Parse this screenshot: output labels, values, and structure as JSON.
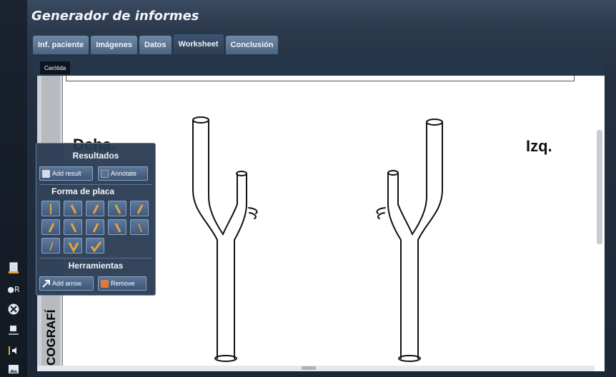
{
  "app": {
    "title": "Generador de informes"
  },
  "tabs": [
    {
      "label": "Inf. paciente"
    },
    {
      "label": "Imágenes"
    },
    {
      "label": "Datos"
    },
    {
      "label": "Worksheet",
      "active": true
    },
    {
      "label": "Conclusión"
    }
  ],
  "subtab": {
    "label": "Carótida"
  },
  "canvas": {
    "label_left": "Dcha.",
    "label_right": "Izq.",
    "vertical_label": "COGRAFÍ"
  },
  "panel": {
    "results_title": "Resultados",
    "add_result_label": "Add result",
    "annotate_label": "Annotate",
    "plaque_title": "Forma de placa",
    "plaque_shapes": [
      "vertical-bar",
      "slash-back",
      "slash-fwd",
      "slash-back",
      "slash-fwd",
      "slash-fwd",
      "slash-back",
      "slash-fwd",
      "slash-back",
      "slash-back-thin",
      "slash-fwd-thin",
      "v-shape",
      "check-shape"
    ],
    "tools_title": "Herramientas",
    "add_arrow_label": "Add arrow",
    "remove_label": "Remove"
  },
  "left_strip": {
    "icons": [
      "document-icon",
      "r-marker-icon",
      "close-circle-icon",
      "stack-icon",
      "volume-icon",
      "image-icon"
    ],
    "r_label": "R"
  },
  "colors": {
    "accent": "#e8a23a",
    "tab_bg": "#5a7594",
    "panel_bg": "#283a52"
  }
}
